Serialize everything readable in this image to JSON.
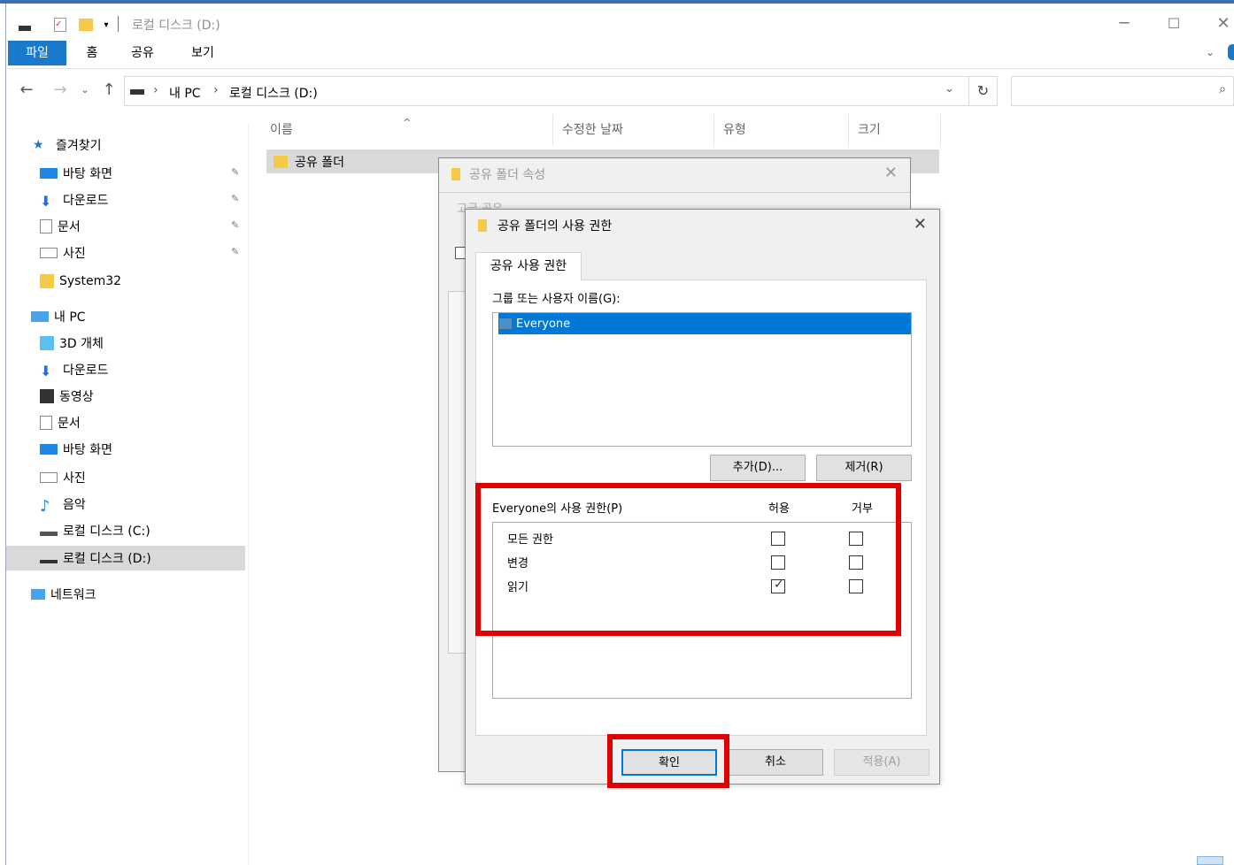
{
  "window": {
    "title": "로컬 디스크 (D:)",
    "controls": [
      "─",
      "☐",
      "✕"
    ]
  },
  "ribbon": {
    "tabs": [
      "파일",
      "홈",
      "공유",
      "보기"
    ]
  },
  "address": {
    "crumbs": [
      "내 PC",
      "로컬 디스크 (D:)"
    ],
    "separator": "›"
  },
  "nav": {
    "quick_access": "즐겨찾기",
    "quick_items": [
      "바탕 화면",
      "다운로드",
      "문서",
      "사진",
      "System32"
    ],
    "this_pc": "내 PC",
    "pc_items": [
      "3D 개체",
      "다운로드",
      "동영상",
      "문서",
      "바탕 화면",
      "사진",
      "음악",
      "로컬 디스크 (C:)",
      "로컬 디스크 (D:)"
    ],
    "network": "네트워크"
  },
  "filelist": {
    "columns": [
      "이름",
      "수정한 날짜",
      "유형",
      "크기"
    ],
    "folder_name": "공유 폴더"
  },
  "props_dialog": {
    "title": "공유 폴더 속성",
    "tab": "고급 공유"
  },
  "perm_dialog": {
    "title": "공유 폴더의 사용 권한",
    "tab": "공유 사용 권한",
    "group_label": "그룹 또는 사용자 이름(G):",
    "selected_user": "Everyone",
    "add_button": "추가(D)...",
    "remove_button": "제거(R)",
    "perm_label": "Everyone의 사용 권한(P)",
    "allow_header": "허용",
    "deny_header": "거부",
    "permissions": [
      {
        "name": "모든 권한",
        "allow": false,
        "deny": false
      },
      {
        "name": "변경",
        "allow": false,
        "deny": false
      },
      {
        "name": "읽기",
        "allow": true,
        "deny": false
      }
    ],
    "ok_button": "확인",
    "cancel_button": "취소",
    "apply_button": "적용(A)"
  },
  "colors": {
    "accent": "#1979ca",
    "selection": "#0078d7",
    "highlight": "#e00000"
  }
}
